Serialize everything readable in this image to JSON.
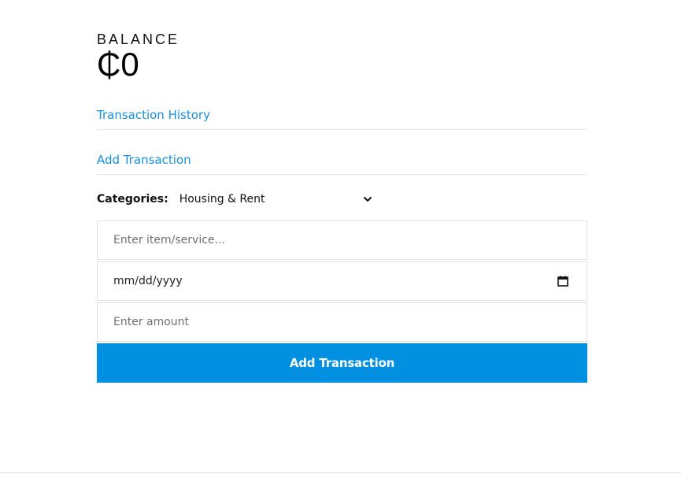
{
  "balance": {
    "label": "BALANCE",
    "value": "₵0"
  },
  "links": {
    "history": "Transaction History",
    "add": "Add Transaction"
  },
  "form": {
    "categories_label": "Categories:",
    "category_selected": "Housing & Rent",
    "item_placeholder": "Enter item/service...",
    "date_placeholder": "mm/dd/yyyy",
    "amount_placeholder": "Enter amount",
    "submit_label": "Add Transaction"
  },
  "icons": {
    "select_chevron": "chevron-down-icon",
    "date_picker": "calendar-icon"
  },
  "colors": {
    "accent": "#0090e1",
    "link": "#1a8fdb",
    "text": "#111111",
    "placeholder": "#6f6f6f",
    "border": "#e2e2e2"
  }
}
